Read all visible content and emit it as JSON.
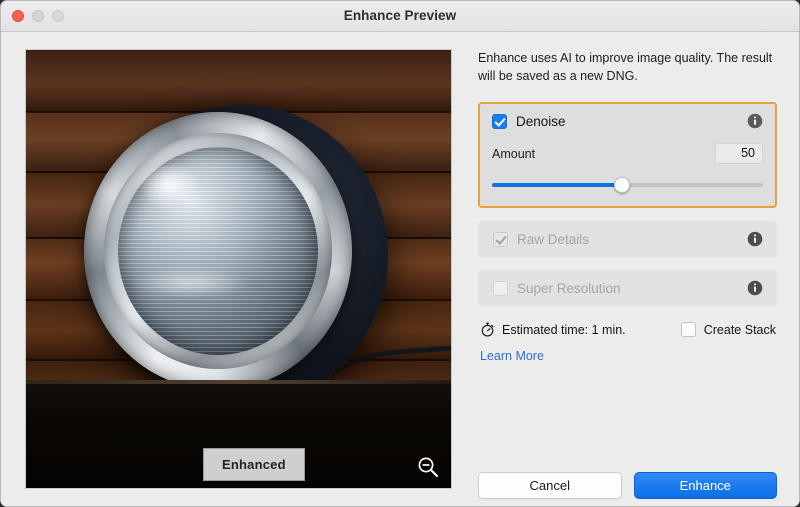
{
  "window": {
    "title": "Enhance Preview",
    "traffic_lights": [
      {
        "name": "close",
        "color": "#fc5f57"
      },
      {
        "name": "minimize",
        "color": "#d4d4d4"
      },
      {
        "name": "maximize",
        "color": "#d9d9d9"
      }
    ]
  },
  "preview": {
    "badge_label": "Enhanced",
    "zoom_icon": "zoom-out-icon",
    "subject": "chrome headlight on dark wood background"
  },
  "panel": {
    "intro_text": "Enhance uses AI to improve image quality. The result will be saved as a new DNG.",
    "focus_ring_color": "#e2a33e",
    "denoise": {
      "label": "Denoise",
      "checked": true,
      "enabled": true,
      "info_icon": "info-icon",
      "amount_label": "Amount",
      "amount_value": "50",
      "slider_percent": 48,
      "slider_color": "#0b72e7"
    },
    "raw_details": {
      "label": "Raw Details",
      "checked": true,
      "enabled": false,
      "info_icon": "info-icon"
    },
    "super_resolution": {
      "label": "Super Resolution",
      "checked": false,
      "enabled": false,
      "info_icon": "info-icon"
    },
    "estimated_time": {
      "icon": "stopwatch-icon",
      "text": "Estimated time: 1 min."
    },
    "create_stack": {
      "label": "Create Stack",
      "checked": false
    },
    "learn_more_label": "Learn More",
    "learn_more_color": "#2a6fd6"
  },
  "footer": {
    "cancel_label": "Cancel",
    "enhance_label": "Enhance",
    "enhance_color": "#0a6fe8"
  }
}
